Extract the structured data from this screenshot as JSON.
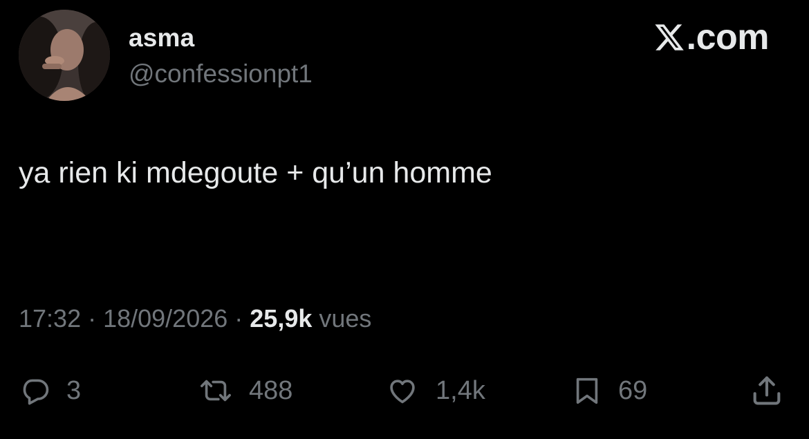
{
  "author": {
    "display_name": "asma",
    "handle": "@confessionpt1"
  },
  "brand": {
    "text": ".com",
    "logo": "x-logo-icon"
  },
  "tweet": {
    "text": "ya rien ki mdegoute + qu’un homme"
  },
  "meta": {
    "time": "17:32",
    "separator1": " · ",
    "date": "18/09/2026",
    "separator2": " · ",
    "views_count": "25,9k",
    "views_label": " vues"
  },
  "actions": {
    "reply": {
      "icon": "reply-icon",
      "count": "3"
    },
    "retweet": {
      "icon": "retweet-icon",
      "count": "488"
    },
    "like": {
      "icon": "heart-icon",
      "count": "1,4k"
    },
    "bookmark": {
      "icon": "bookmark-icon",
      "count": "69"
    },
    "share": {
      "icon": "share-icon"
    }
  },
  "colors": {
    "background": "#000000",
    "primary_text": "#e7e9ea",
    "secondary_text": "#71767b"
  }
}
